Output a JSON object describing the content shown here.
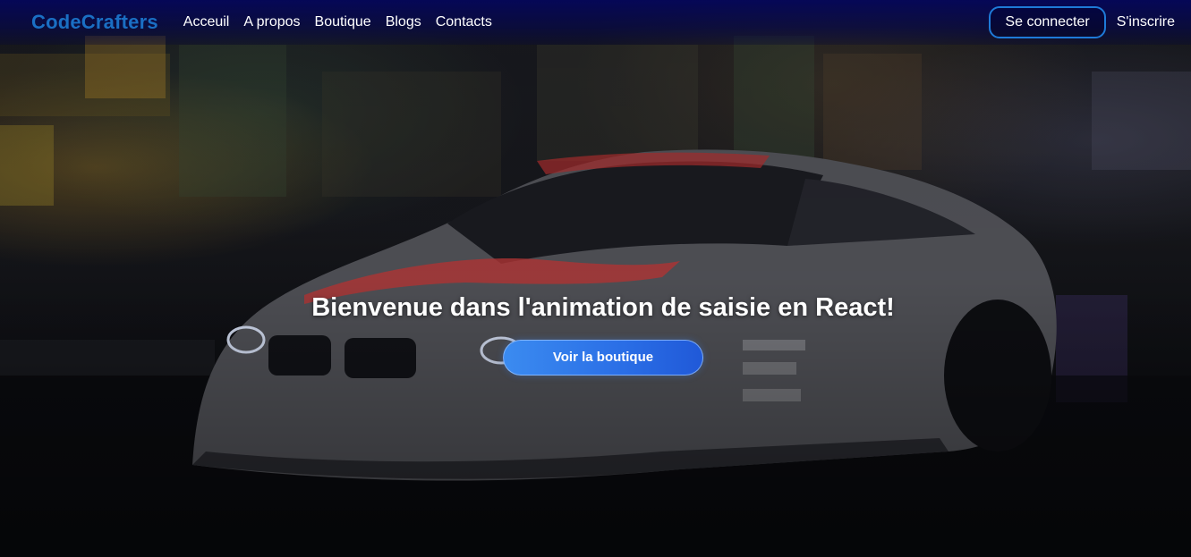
{
  "navbar": {
    "brand": "CodeCrafters",
    "links": [
      "Acceuil",
      "A propos",
      "Boutique",
      "Blogs",
      "Contacts"
    ],
    "login_label": "Se connecter",
    "signup_label": "S'inscrire"
  },
  "hero": {
    "title": "Bienvenue dans l'animation de saisie en React!",
    "cta_label": "Voir la boutique"
  },
  "colors": {
    "brand": "#1a6fc4",
    "navbar_bg": "#04065a",
    "cta_bg": "#2a6ee6",
    "login_border": "#1e7ad8"
  }
}
